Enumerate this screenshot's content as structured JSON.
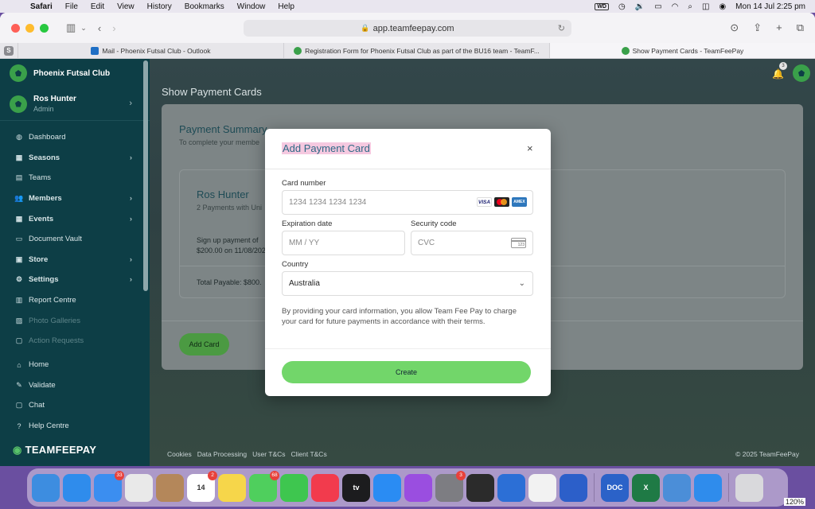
{
  "menubar": {
    "items": [
      "Safari",
      "File",
      "Edit",
      "View",
      "History",
      "Bookmarks",
      "Window",
      "Help"
    ],
    "wd_label": "WD",
    "datetime": "Mon 14 Jul  2:25 pm"
  },
  "browser": {
    "url": "app.teamfeepay.com",
    "tabs": [
      {
        "label": "Mail - Phoenix Futsal Club - Outlook",
        "favicon_color": "#1f6fc5"
      },
      {
        "label": "Registration Form for Phoenix Futsal Club as part of the BU16 team - TeamF...",
        "favicon_color": "#3aa04a"
      },
      {
        "label": "Show Payment Cards - TeamFeePay",
        "favicon_color": "#3aa04a"
      }
    ],
    "tab_group_letter": "S"
  },
  "sidebar": {
    "club_name": "Phoenix Futsal Club",
    "user_name": "Ros Hunter",
    "user_role": "Admin",
    "nav": [
      {
        "label": "Dashboard",
        "icon": "palette-icon",
        "glyph": "◍",
        "bold": false,
        "chevron": false,
        "dim": false
      },
      {
        "label": "Seasons",
        "icon": "calendar-icon",
        "glyph": "▦",
        "bold": true,
        "chevron": true,
        "dim": false
      },
      {
        "label": "Teams",
        "icon": "table-icon",
        "glyph": "▤",
        "bold": false,
        "chevron": false,
        "dim": false
      },
      {
        "label": "Members",
        "icon": "users-icon",
        "glyph": "👥",
        "bold": true,
        "chevron": true,
        "dim": false
      },
      {
        "label": "Events",
        "icon": "calendar-icon",
        "glyph": "▦",
        "bold": true,
        "chevron": true,
        "dim": false
      },
      {
        "label": "Document Vault",
        "icon": "vault-icon",
        "glyph": "▭",
        "bold": false,
        "chevron": false,
        "dim": false
      },
      {
        "label": "Store",
        "icon": "store-icon",
        "glyph": "▣",
        "bold": true,
        "chevron": true,
        "dim": false
      },
      {
        "label": "Settings",
        "icon": "gear-icon",
        "glyph": "⚙",
        "bold": true,
        "chevron": true,
        "dim": false
      },
      {
        "label": "Report Centre",
        "icon": "report-icon",
        "glyph": "▥",
        "bold": false,
        "chevron": false,
        "dim": false
      },
      {
        "label": "Photo Galleries",
        "icon": "photo-icon",
        "glyph": "▨",
        "bold": false,
        "chevron": false,
        "dim": true
      },
      {
        "label": "Action Requests",
        "icon": "action-icon",
        "glyph": "▢",
        "bold": false,
        "chevron": false,
        "dim": true
      }
    ],
    "nav2": [
      {
        "label": "Home",
        "icon": "home-icon",
        "glyph": "⌂"
      },
      {
        "label": "Validate",
        "icon": "validate-icon",
        "glyph": "✎"
      },
      {
        "label": "Chat",
        "icon": "chat-icon",
        "glyph": "▢"
      },
      {
        "label": "Help Centre",
        "icon": "help-icon",
        "glyph": "?"
      }
    ],
    "brand_prefix": "TEAM",
    "brand_suffix": "FEEPAY"
  },
  "main": {
    "page_title": "Show Payment Cards",
    "notification_count": "3",
    "summary_title": "Payment Summary",
    "summary_sub": "To complete your membe",
    "member_name": "Ros Hunter",
    "payments_count": "2 Payments with Uni",
    "signup_line1": "Sign up payment of",
    "signup_line2": "$200.00 on 11/08/202",
    "total_payable": "Total Payable: $800.",
    "add_card_label": "Add Card",
    "footer_links": [
      "Cookies",
      "Data Processing",
      "User T&Cs",
      "Client T&Cs"
    ],
    "copyright": "© 2025 TeamFeePay"
  },
  "modal": {
    "title": "Add Payment Card",
    "close": "×",
    "card_number_label": "Card number",
    "card_number_placeholder": "1234 1234 1234 1234",
    "visa": "VISA",
    "amex": "AMEX",
    "expiry_label": "Expiration date",
    "expiry_placeholder": "MM / YY",
    "security_label": "Security code",
    "security_placeholder": "CVC",
    "cvc_digits": "123",
    "country_label": "Country",
    "country_value": "Australia",
    "note": "By providing your card information, you allow Team Fee Pay to charge your card for future payments in accordance with their terms.",
    "create_label": "Create"
  },
  "dock": {
    "apps": [
      {
        "name": "finder-icon",
        "color": "#3d8de0",
        "label": "",
        "badge": ""
      },
      {
        "name": "safari-icon",
        "color": "#2f8cec",
        "label": "",
        "badge": ""
      },
      {
        "name": "mail-icon",
        "color": "#3b8ef0",
        "label": "",
        "badge": "33"
      },
      {
        "name": "chrome-icon",
        "color": "#e9e9e9",
        "label": "",
        "badge": ""
      },
      {
        "name": "contacts-icon",
        "color": "#b4875a",
        "label": "",
        "badge": ""
      },
      {
        "name": "calendar-icon",
        "color": "#ffffff",
        "label": "14",
        "badge": "2"
      },
      {
        "name": "notes-icon",
        "color": "#f6d64a",
        "label": "",
        "badge": ""
      },
      {
        "name": "messages-icon",
        "color": "#4fcf5d",
        "label": "",
        "badge": "68"
      },
      {
        "name": "facetime-icon",
        "color": "#3ec64f",
        "label": "",
        "badge": ""
      },
      {
        "name": "music-icon",
        "color": "#f23b4d",
        "label": "",
        "badge": ""
      },
      {
        "name": "tv-icon",
        "color": "#1c1c1e",
        "label": "tv",
        "badge": ""
      },
      {
        "name": "appstore-icon",
        "color": "#2a8cf3",
        "label": "",
        "badge": ""
      },
      {
        "name": "podcasts-icon",
        "color": "#9a4ee0",
        "label": "",
        "badge": ""
      },
      {
        "name": "settings-icon",
        "color": "#7d7d82",
        "label": "",
        "badge": "3"
      },
      {
        "name": "activity-monitor-icon",
        "color": "#2b2b2b",
        "label": "",
        "badge": ""
      },
      {
        "name": "preview-icon",
        "color": "#2c6fd6",
        "label": "",
        "badge": ""
      },
      {
        "name": "photos-icon",
        "color": "#f2f2f2",
        "label": "",
        "badge": ""
      },
      {
        "name": "image-capture-icon",
        "color": "#2c5fc9",
        "label": "",
        "badge": ""
      }
    ],
    "apps2": [
      {
        "name": "doc-icon",
        "color": "#2b62c8",
        "label": "DOC",
        "badge": ""
      },
      {
        "name": "excel-icon",
        "color": "#1f7a45",
        "label": "X",
        "badge": ""
      },
      {
        "name": "network-icon",
        "color": "#4b8ed8",
        "label": "",
        "badge": ""
      },
      {
        "name": "safari-preview-icon",
        "color": "#2f8cec",
        "label": "",
        "badge": ""
      }
    ],
    "trash_color": "#d9d9dc",
    "zoom_level": "120%"
  }
}
